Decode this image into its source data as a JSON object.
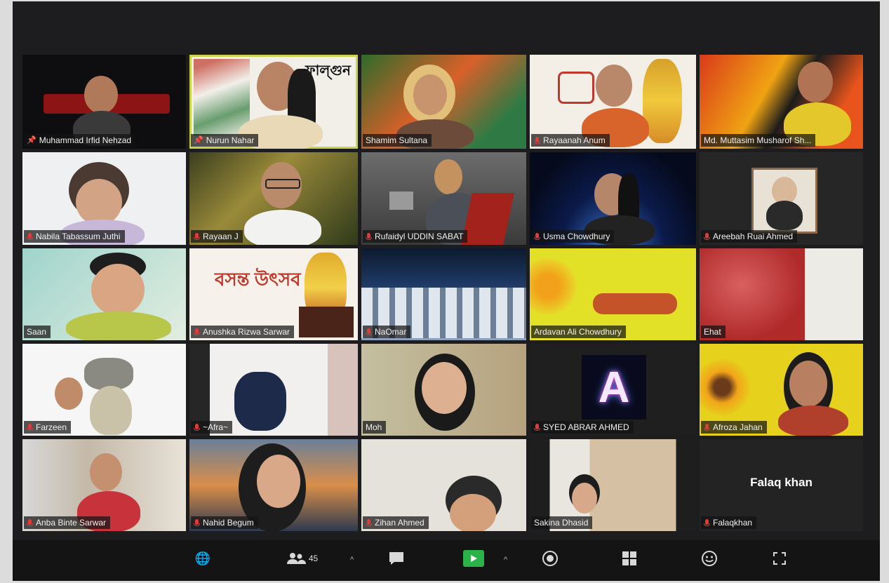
{
  "meeting": {
    "participants": [
      {
        "name": "Muhammad Irfid Nehzad",
        "pinned": true
      },
      {
        "name": "Nurun Nahar",
        "pinned": true,
        "banner": "ফাল্গুন"
      },
      {
        "name": "Shamim Sultana"
      },
      {
        "name": "Rayaanah Anum"
      },
      {
        "name": "Md. Muttasim Musharof Sh..."
      },
      {
        "name": "Nabila Tabassum Juthi"
      },
      {
        "name": "Rayaan J"
      },
      {
        "name": "Rufaidyl UDDIN SABAT"
      },
      {
        "name": "Usma Chowdhury"
      },
      {
        "name": "Areebah Ruai Ahmed"
      },
      {
        "name": "Saan"
      },
      {
        "name": "Anushka Rizwa Sarwar",
        "banner": "বসন্ত উৎসব"
      },
      {
        "name": "NaOmar"
      },
      {
        "name": "Ardavan Ali Chowdhury"
      },
      {
        "name": "Ehat"
      },
      {
        "name": "Farzeen"
      },
      {
        "name": "~Afra~"
      },
      {
        "name": "Moh"
      },
      {
        "name": "SYED ABRAR AHMED",
        "avatar_letter": "A"
      },
      {
        "name": "Afroza Jahan"
      },
      {
        "name": "Anba Binte Sarwar"
      },
      {
        "name": "Nahid Begum"
      },
      {
        "name": "Zihan Ahmed"
      },
      {
        "name": "Sakina Dhasid"
      },
      {
        "name": "Falaqkhan",
        "display_name": "Falaq khan"
      }
    ]
  },
  "toolbar": {
    "participants_count": "45"
  },
  "colors": {
    "active_speaker_border": "#c9d34a",
    "video_on_icon": "#2bb34a",
    "muted_mic": "#e03b3b"
  }
}
